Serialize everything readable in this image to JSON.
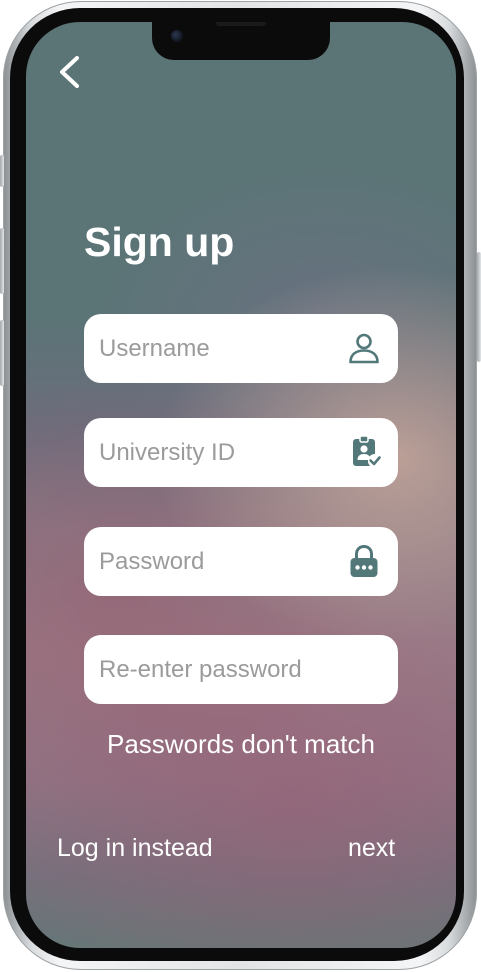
{
  "screen": {
    "title": "Sign up",
    "back_icon": "chevron-left-icon"
  },
  "form": {
    "username": {
      "placeholder": "Username",
      "icon": "user-icon"
    },
    "university_id": {
      "placeholder": "University ID",
      "icon": "id-badge-check-icon"
    },
    "password": {
      "placeholder": "Password",
      "icon": "lock-icon"
    },
    "reenter_password": {
      "placeholder": "Re-enter password"
    },
    "error": "Passwords don't match"
  },
  "footer": {
    "login_label": "Log in instead",
    "next_label": "next"
  },
  "colors": {
    "icon": "#52787a",
    "text": "#ffffff",
    "placeholder": "#9b9b9b",
    "field_bg": "#ffffff"
  }
}
